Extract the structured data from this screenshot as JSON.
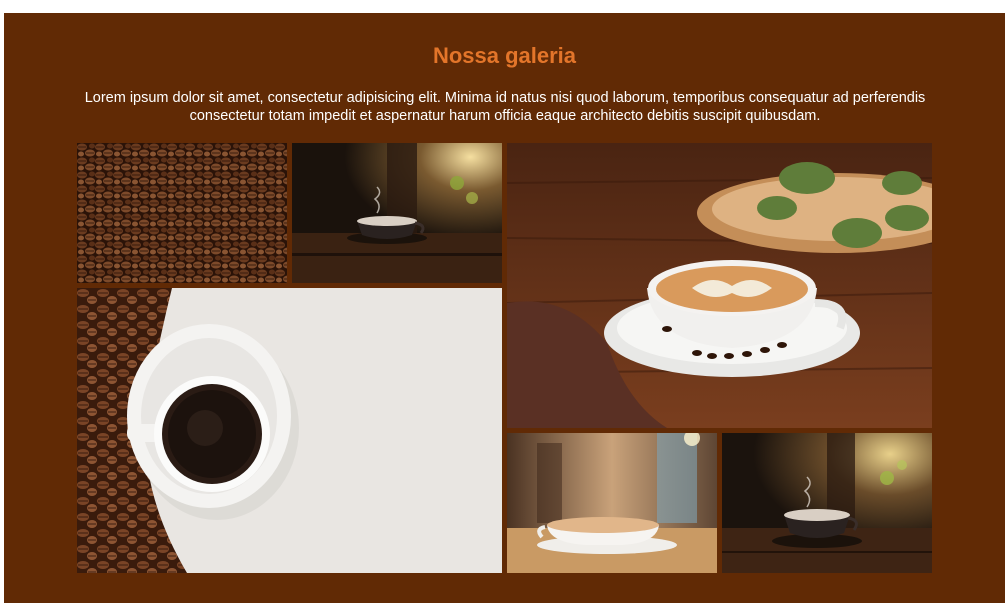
{
  "gallery": {
    "title": "Nossa galeria",
    "description": "Lorem ipsum dolor sit amet, consectetur adipisicing elit. Minima id natus nisi quod laborum, temporibus consequatur ad perferendis consectetur totam impedit et aspernatur harum officia eaque architecto debitis suscipit quibusdam.",
    "images": [
      {
        "name": "coffee-beans-image"
      },
      {
        "name": "steaming-cup-dark-table-image"
      },
      {
        "name": "latte-art-cup-wood-table-image"
      },
      {
        "name": "black-coffee-cup-with-beans-image"
      },
      {
        "name": "cafe-cup-blurred-background-image"
      },
      {
        "name": "steaming-cup-window-light-image"
      }
    ]
  },
  "colors": {
    "section_background": "#612a05",
    "title": "#e3752a",
    "text": "#ffffff"
  }
}
